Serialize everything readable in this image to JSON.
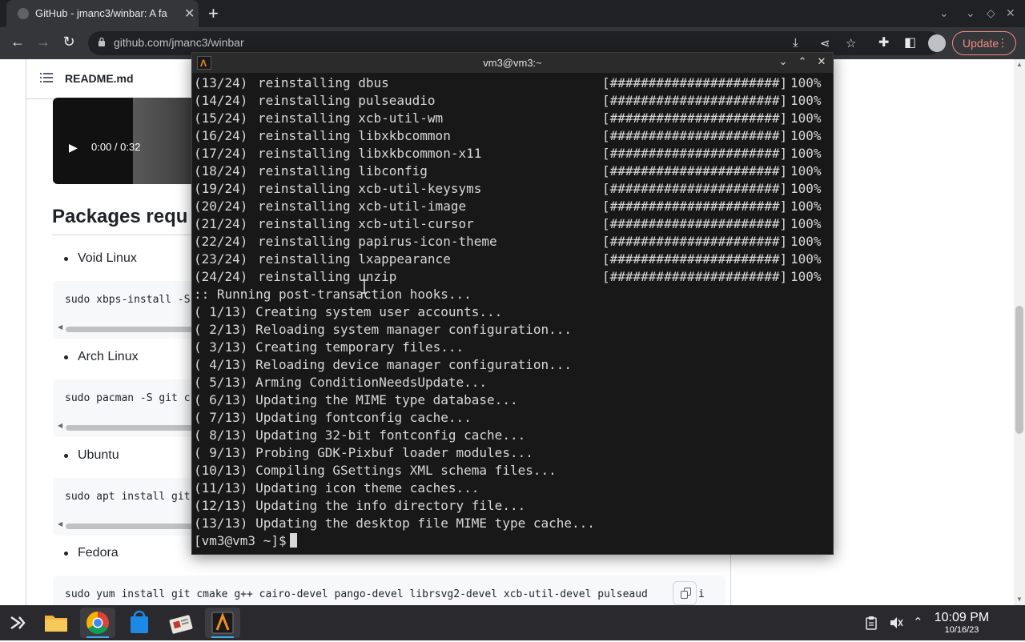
{
  "browser": {
    "tab_title": "GitHub - jmanc3/winbar: A fa",
    "url": "github.com/jmanc3/winbar",
    "update_label": "Update"
  },
  "page": {
    "readme_label": "README.md",
    "video_time": "0:00 / 0:32",
    "video_progress": 0.0,
    "section_heading": "Packages requ",
    "packages": [
      {
        "name": "Void Linux",
        "command": "sudo xbps-install -S"
      },
      {
        "name": "Arch Linux",
        "command": "sudo pacman -S git c"
      },
      {
        "name": "Ubuntu",
        "command": "sudo apt install git"
      },
      {
        "name": "Fedora",
        "command": "sudo yum install git cmake g++ cairo-devel pango-devel librsvg2-devel xcb-util-devel pulseaud"
      }
    ],
    "fedora_trailing": "i"
  },
  "terminal": {
    "title": "vm3@vm3:~",
    "reinstall_lines": [
      {
        "num": "(13/24)",
        "pkg": "reinstalling dbus"
      },
      {
        "num": "(14/24)",
        "pkg": "reinstalling pulseaudio"
      },
      {
        "num": "(15/24)",
        "pkg": "reinstalling xcb-util-wm"
      },
      {
        "num": "(16/24)",
        "pkg": "reinstalling libxkbcommon"
      },
      {
        "num": "(17/24)",
        "pkg": "reinstalling libxkbcommon-x11"
      },
      {
        "num": "(18/24)",
        "pkg": "reinstalling libconfig"
      },
      {
        "num": "(19/24)",
        "pkg": "reinstalling xcb-util-keysyms"
      },
      {
        "num": "(20/24)",
        "pkg": "reinstalling xcb-util-image"
      },
      {
        "num": "(21/24)",
        "pkg": "reinstalling xcb-util-cursor"
      },
      {
        "num": "(22/24)",
        "pkg": "reinstalling papirus-icon-theme"
      },
      {
        "num": "(23/24)",
        "pkg": "reinstalling lxappearance"
      },
      {
        "num": "(24/24)",
        "pkg": "reinstalling unzip"
      }
    ],
    "progress_bar": "[######################]",
    "progress_pct": "100%",
    "hooks_line": ":: Running post-transaction hooks...",
    "hook_lines": [
      "( 1/13) Creating system user accounts...",
      "( 2/13) Reloading system manager configuration...",
      "( 3/13) Creating temporary files...",
      "( 4/13) Reloading device manager configuration...",
      "( 5/13) Arming ConditionNeedsUpdate...",
      "( 6/13) Updating the MIME type database...",
      "( 7/13) Updating fontconfig cache...",
      "( 8/13) Updating 32-bit fontconfig cache...",
      "( 9/13) Probing GDK-Pixbuf loader modules...",
      "(10/13) Compiling GSettings XML schema files...",
      "(11/13) Updating icon theme caches...",
      "(12/13) Updating the info directory file...",
      "(13/13) Updating the desktop file MIME type cache..."
    ],
    "prompt": "[vm3@vm3 ~]$"
  },
  "taskbar": {
    "time": "10:09 PM",
    "date": "10/16/23",
    "apps": [
      "app-launcher-icon",
      "file-manager-icon",
      "chrome-icon",
      "app-store-icon",
      "settings-icon",
      "terminal-icon"
    ]
  },
  "colors": {
    "terminal_bg": "#181818",
    "terminal_text": "#d8d8d8",
    "taskbar_bg": "#2a2a2e",
    "update_accent": "#f28b82"
  }
}
